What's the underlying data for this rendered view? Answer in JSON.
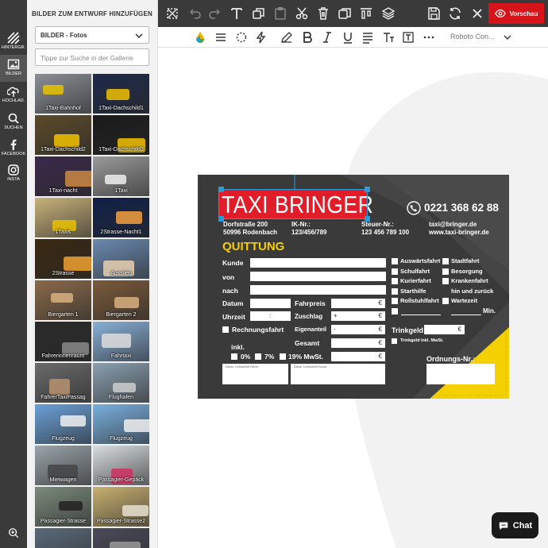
{
  "sidebar": {
    "items": [
      {
        "label": "HINTERGR.",
        "icon": "stripes-icon"
      },
      {
        "label": "BILDER",
        "icon": "image-icon"
      },
      {
        "label": "HOCHLAD.",
        "icon": "upload-icon"
      },
      {
        "label": "SUCHEN",
        "icon": "search-icon"
      },
      {
        "label": "FACEBOOK",
        "icon": "facebook-icon"
      },
      {
        "label": "INSTA",
        "icon": "instagram-icon"
      }
    ]
  },
  "panel": {
    "title": "BILDER ZUM ENTWURF HINZUFÜGEN",
    "category": "BILDER - Fotos",
    "search_placeholder": "Tippe zur Suche in der Gallerie",
    "tiles": [
      {
        "label": "1Taxi-Bahnhof",
        "bg": "#8a8f95",
        "accent": "#e8c200"
      },
      {
        "label": "1Taxi-Dachschild1",
        "bg": "#1f2a4a",
        "accent": "#f0c000"
      },
      {
        "label": "1Taxi-Dachschild2",
        "bg": "#5b4a2a",
        "accent": "#f2c200"
      },
      {
        "label": "1Taxi-Dachschild3",
        "bg": "#1a1a1a",
        "accent": "#f2c200"
      },
      {
        "label": "1Taxi-nacht",
        "bg": "#3a2a4a",
        "accent": "#c84"
      },
      {
        "label": "1Taxi",
        "bg": "#9a9a9a",
        "accent": "#eee"
      },
      {
        "label": "1Taxis",
        "bg": "#c8b27a",
        "accent": "#e8c000"
      },
      {
        "label": "2Strasse-Nacht1",
        "bg": "#10204a",
        "accent": "#f5a040"
      },
      {
        "label": "2Strasse",
        "bg": "#3a2810",
        "accent": "#f0a030"
      },
      {
        "label": "Ausstieg",
        "bg": "#6a8ab0",
        "accent": "#e8d0b0"
      },
      {
        "label": "Biergarten 1",
        "bg": "#8a6a4a",
        "accent": "#d8b080"
      },
      {
        "label": "Biergarten 2",
        "bg": "#7a5a3a",
        "accent": "#d8b080"
      },
      {
        "label": "Fahrerinnenraum",
        "bg": "#2a2a2a",
        "accent": "#888"
      },
      {
        "label": "Fahrtaxi",
        "bg": "#88b0d8",
        "accent": "#ddd"
      },
      {
        "label": "FahrerTaxiPassag",
        "bg": "#6a6a6a",
        "accent": "#b89070"
      },
      {
        "label": "Flughafen",
        "bg": "#8aa0b0",
        "accent": "#ccc"
      },
      {
        "label": "Flugzeug",
        "bg": "#6aa0d8",
        "accent": "#eee"
      },
      {
        "label": "Flugzeug",
        "bg": "#7ab0e0",
        "accent": "#eee"
      },
      {
        "label": "Mietwagen",
        "bg": "#9aa4aa",
        "accent": "#444"
      },
      {
        "label": "Passagier-Gepäck",
        "bg": "#d8dde0",
        "accent": "#d03060"
      },
      {
        "label": "Passagier-Strasse",
        "bg": "#7a8a7a",
        "accent": "#222"
      },
      {
        "label": "Passagier-Strasse2",
        "bg": "#c8b070",
        "accent": "#e8e0d0"
      },
      {
        "label": "",
        "bg": "#5a6a7a",
        "accent": "#999"
      },
      {
        "label": "",
        "bg": "#4a4a5a",
        "accent": "#999"
      }
    ]
  },
  "toolbar": {
    "icons": [
      "magic-wand-icon",
      "undo-icon",
      "redo-icon",
      "text-icon",
      "copy-style-icon",
      "paste-icon",
      "cut-icon",
      "delete-icon",
      "duplicate-icon",
      "align-top-icon",
      "layers-icon",
      "save-icon",
      "refresh-icon",
      "close-icon"
    ],
    "preview_label": "Vorschau"
  },
  "format_bar": {
    "font": "Roboto Con...",
    "icons": [
      "color-drop-icon",
      "line-weight-icon",
      "effects-icon",
      "lightning-icon",
      "pen-icon",
      "bold-icon",
      "italic-icon",
      "underline-icon",
      "align-icon",
      "text-size-icon",
      "text-box-icon",
      "more-icon"
    ]
  },
  "card": {
    "title": "TAXI BRINGER",
    "phone": "0221 368 62 88",
    "address1": "Dorfstraße 200",
    "address2": "50996 Rodenbach",
    "ik_label": "IK-Nr.:",
    "ik_value": "123/456/789",
    "tax_label": "Steuer-Nr.:",
    "tax_value": "123 456 789 100",
    "email": "taxi@bringer.de",
    "web": "www.taxi-bringer.de",
    "heading": "QUITTUNG",
    "labels": {
      "kunde": "Kunde",
      "von": "von",
      "nach": "nach",
      "datum": "Datum",
      "uhrzeit": "Uhrzeit",
      "fahrpreis": "Fahrpreis",
      "zuschlag": "Zuschlag",
      "eigenanteil": "Eigenanteil",
      "gesamt": "Gesamt",
      "rechnungsfahrt": "Rechnungsfahrt",
      "inkl": "inkl.",
      "mwst0": "0%",
      "mwst7": "7%",
      "mwst19": "19% MwSt.",
      "trinkgeld": "Trinkgeld",
      "trinkgeld_inkl": "Trinkgeld inkl. MwSt.",
      "ordnungs": "Ordnungs-Nr.:",
      "min": "Min.",
      "sig_driver": "Datum, Unterschrift Fahrer",
      "sig_customer": "Datum, Unterschrift Kunde"
    },
    "symbols": {
      "euro": "€",
      "colon": ":",
      "plus": "+",
      "minus": "-"
    },
    "checks_left": [
      "Auswärtsfahrt",
      "Schulfahrt",
      "Kurierfahrt",
      "Starthilfe",
      "Rollstuhlfahrt"
    ],
    "checks_right": [
      "Stadtfahrt",
      "Besorgung",
      "Krankenfahrt",
      "hin und zurück",
      "Wartezeit"
    ],
    "colors": {
      "bg": "#3a3a3a",
      "yellow": "#f5d000",
      "red": "#e11d2a"
    }
  },
  "chat": {
    "label": "Chat"
  }
}
